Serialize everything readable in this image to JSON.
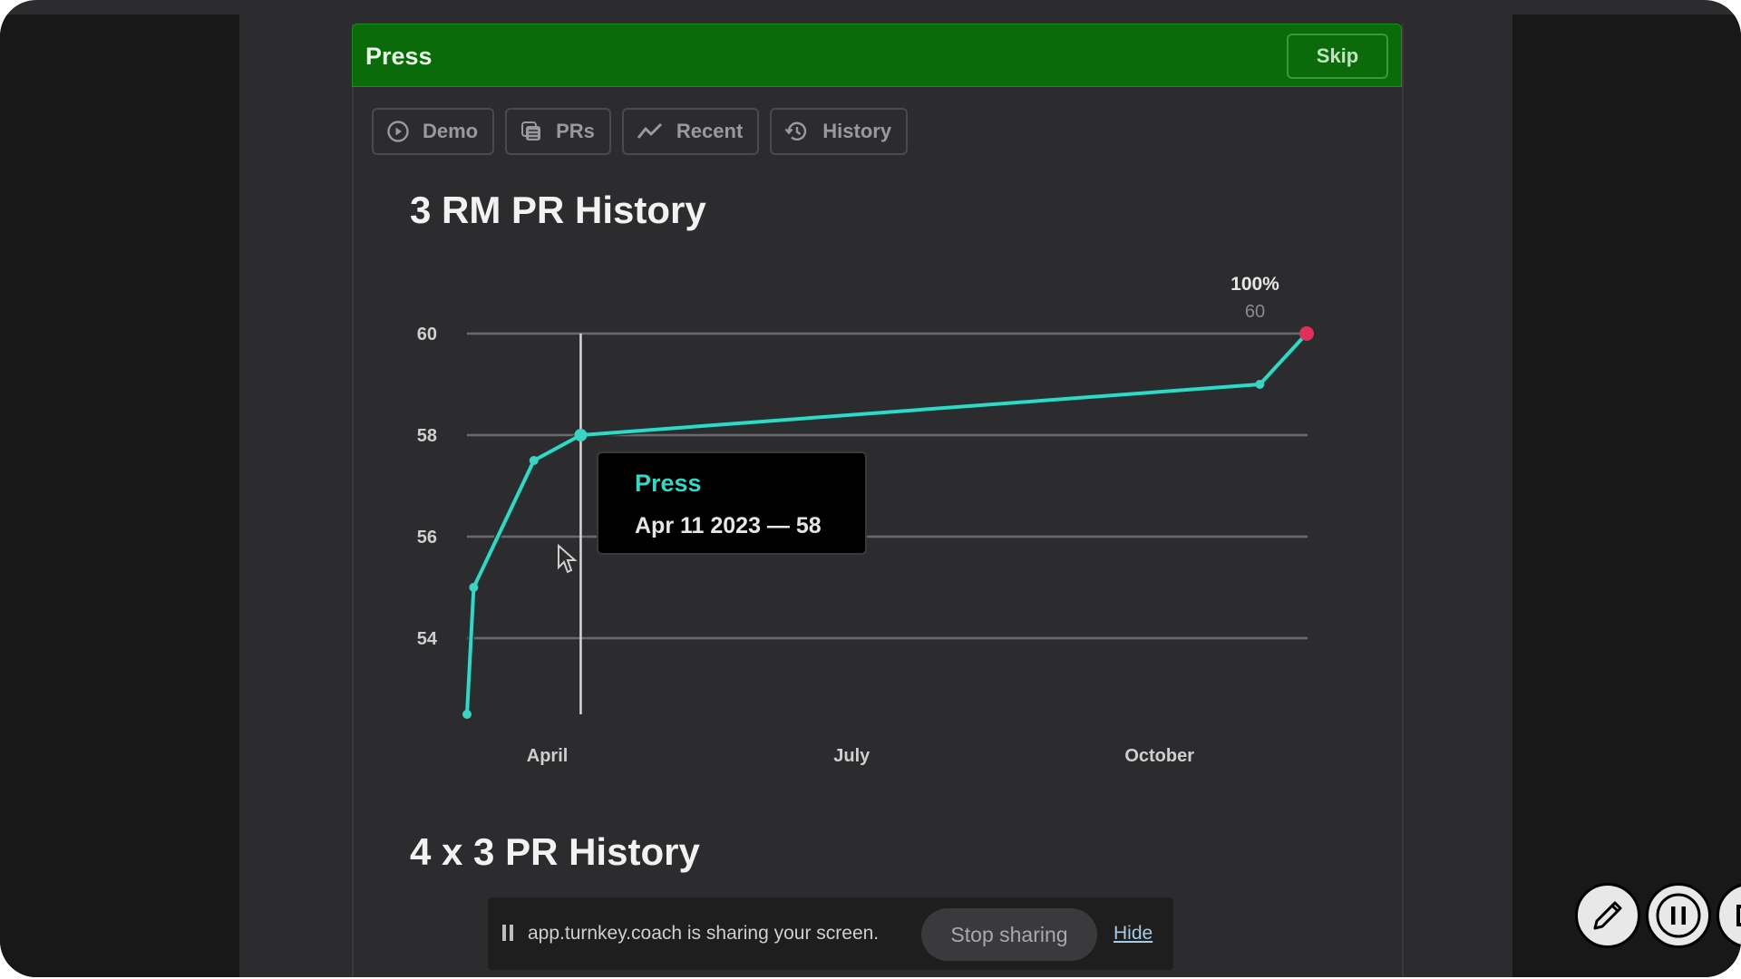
{
  "header": {
    "title": "Press",
    "skip_label": "Skip"
  },
  "tabs": [
    {
      "label": "Demo",
      "icon": "play-circle-icon"
    },
    {
      "label": "PRs",
      "icon": "stack-icon"
    },
    {
      "label": "Recent",
      "icon": "trend-line-icon"
    },
    {
      "label": "History",
      "icon": "history-icon"
    }
  ],
  "sections": {
    "first_title": "3 RM PR History",
    "second_title": "4 x 3 PR History"
  },
  "tooltip": {
    "series": "Press",
    "value": "Apr 11 2023 — 58"
  },
  "share_bar": {
    "message": "app.turnkey.coach is sharing your screen.",
    "stop_label": "Stop sharing",
    "hide_label": "Hide"
  },
  "floating_controls": [
    {
      "icon": "pencil-icon"
    },
    {
      "icon": "pause-icon"
    },
    {
      "icon": "stop-icon"
    }
  ],
  "colors": {
    "header_green": "#0b6b0b",
    "line": "#3fd1c2",
    "max_point": "#e0305a"
  },
  "chart_data": {
    "type": "line",
    "title": "3 RM PR History",
    "series": [
      {
        "name": "Press",
        "points": [
          {
            "date": "2023-03-08",
            "value": 52.5
          },
          {
            "date": "2023-03-10",
            "value": 55
          },
          {
            "date": "2023-03-28",
            "value": 57.5
          },
          {
            "date": "2023-04-11",
            "value": 58
          },
          {
            "date": "2023-10-31",
            "value": 59
          },
          {
            "date": "2023-11-14",
            "value": 60
          }
        ]
      }
    ],
    "x_ticks": [
      {
        "label": "April",
        "date": "2023-04-01"
      },
      {
        "label": "July",
        "date": "2023-07-01"
      },
      {
        "label": "October",
        "date": "2023-10-01"
      }
    ],
    "y_ticks": [
      54,
      56,
      58,
      60
    ],
    "ylim": [
      52.5,
      60
    ],
    "xlim": [
      "2023-03-08",
      "2023-11-14"
    ],
    "grid": true,
    "max_annotation": {
      "percent_label": "100%",
      "value_label": "60"
    },
    "hover": {
      "date": "2023-04-11",
      "value": 58
    }
  }
}
